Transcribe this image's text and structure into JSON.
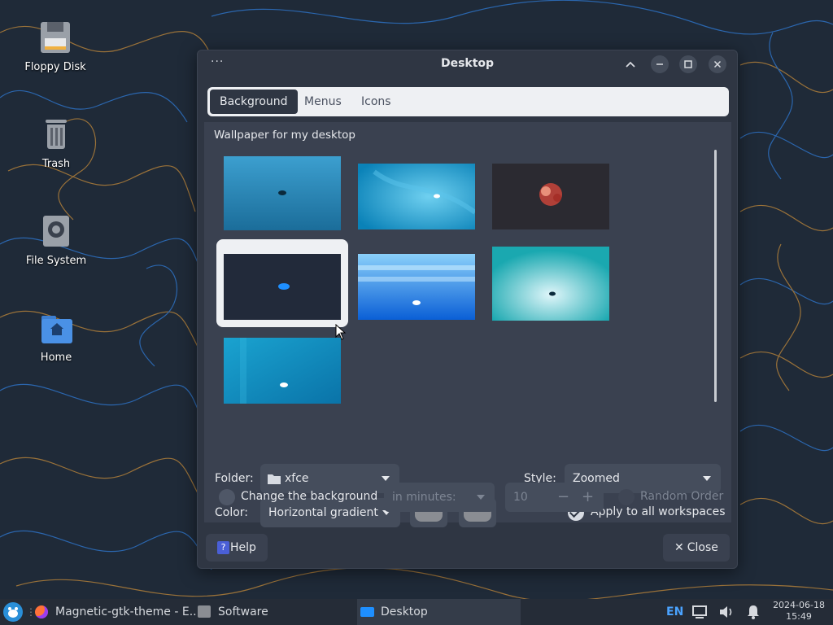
{
  "desktop": {
    "icons": [
      {
        "label": "Floppy Disk",
        "icon": "floppy-disk-icon"
      },
      {
        "label": "Trash",
        "icon": "trash-icon"
      },
      {
        "label": "File System",
        "icon": "drive-icon"
      },
      {
        "label": "Home",
        "icon": "home-folder-icon"
      }
    ]
  },
  "dialog": {
    "title": "Desktop",
    "menu_glyph": "···",
    "tabs": [
      "Background",
      "Menus",
      "Icons"
    ],
    "active_tab": "Background",
    "wallpaper_label": "Wallpaper for my desktop",
    "wallpapers": [
      {
        "colors": [
          "#3c9fcf",
          "#1b6d9a"
        ],
        "selected": false
      },
      {
        "colors": [
          "#1fb0e0",
          "#0a82b8"
        ],
        "selected": false
      },
      {
        "colors": [
          "#2a2830",
          "#3a3038"
        ],
        "selected": false
      },
      {
        "colors": [
          "#232a3a",
          "#1c2230"
        ],
        "selected": true
      },
      {
        "colors": [
          "#5fb4f4",
          "#0a5fd6"
        ],
        "selected": false
      },
      {
        "colors": [
          "#35d0c0",
          "#0d8a9a"
        ],
        "selected": false
      },
      {
        "colors": [
          "#1aa3d0",
          "#0a73a8"
        ],
        "selected": false
      }
    ],
    "folder_label": "Folder:",
    "folder_value": "xfce",
    "style_label": "Style:",
    "style_value": "Zoomed",
    "color_label": "Color:",
    "color_value": "Horizontal gradient",
    "color1": "#8a8d93",
    "color2": "#8a8d93",
    "apply_all_label": "Apply to all workspaces",
    "apply_all_checked": true,
    "change_bg_label": "Change the background",
    "change_bg_checked": false,
    "interval_unit": "in minutes:",
    "interval_value": "10",
    "random_order_label": "Random Order",
    "help_label": "Help",
    "help_glyph": "?",
    "close_label": "Close",
    "close_glyph": "✕"
  },
  "taskbar": {
    "items": [
      {
        "label": "Magnetic-gtk-theme - E...",
        "icon": "firefox-icon",
        "active": false
      },
      {
        "label": "Software",
        "icon": "software-icon",
        "active": false
      },
      {
        "label": "Desktop",
        "icon": "desktop-icon",
        "active": true
      }
    ],
    "language": "EN",
    "date": "2024-06-18",
    "time": "15:49"
  },
  "colors": {
    "accent": "#1e8fff",
    "dialog_bg": "#2f3643",
    "panel_bg": "#3a4150"
  }
}
